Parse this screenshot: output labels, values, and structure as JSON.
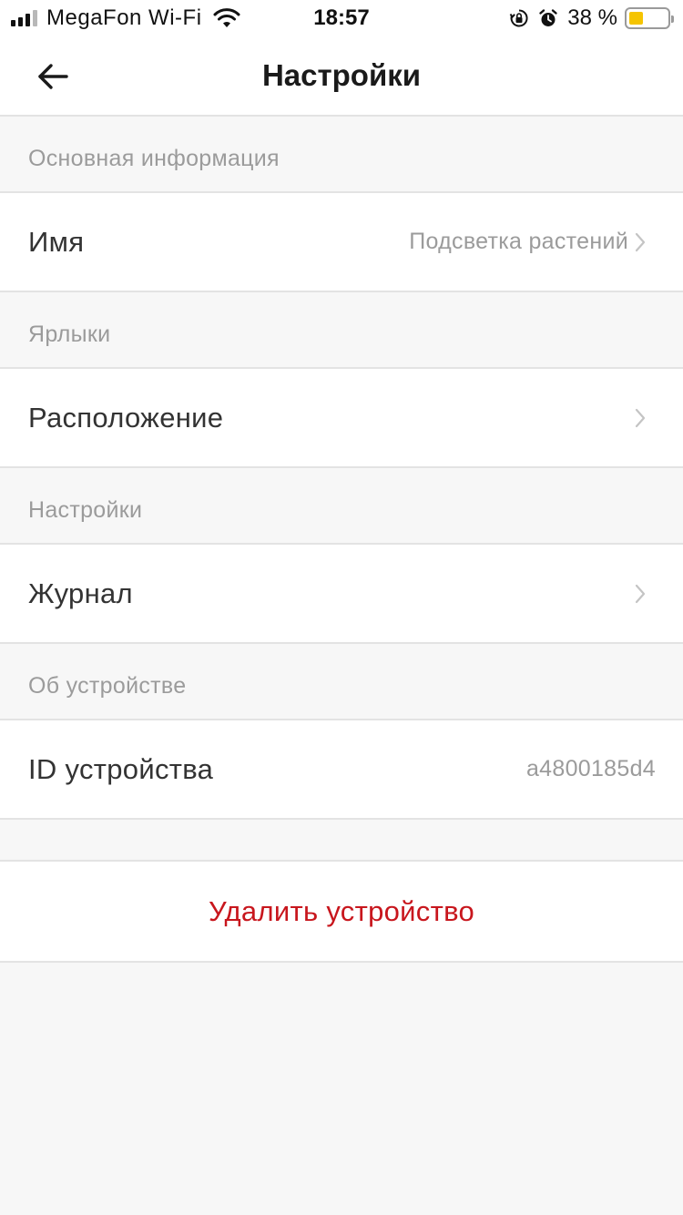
{
  "status_bar": {
    "carrier": "MegaFon Wi-Fi",
    "time": "18:57",
    "battery_percent": "38 %",
    "battery_level": 0.38,
    "battery_color": "#f5c400",
    "icons": [
      "signal-icon",
      "wifi-icon",
      "orientation-lock-icon",
      "alarm-icon",
      "battery-icon"
    ]
  },
  "header": {
    "title": "Настройки",
    "back_icon": "arrow-left-icon"
  },
  "sections": [
    {
      "header": "Основная информация",
      "rows": [
        {
          "label": "Имя",
          "value": "Подсветка растений",
          "chevron": true
        }
      ]
    },
    {
      "header": "Ярлыки",
      "rows": [
        {
          "label": "Расположение",
          "value": "",
          "chevron": true
        }
      ]
    },
    {
      "header": "Настройки",
      "rows": [
        {
          "label": "Журнал",
          "value": "",
          "chevron": true
        }
      ]
    },
    {
      "header": "Об устройстве",
      "rows": [
        {
          "label": "ID устройства",
          "value": "a4800185d4",
          "chevron": false
        }
      ]
    }
  ],
  "delete_button": {
    "label": "Удалить устройство",
    "color": "#c8161d"
  },
  "colors": {
    "background": "#f7f7f7",
    "surface": "#ffffff",
    "divider": "#e3e3e3",
    "secondary_text": "#9b9b9b",
    "primary_text": "#333333"
  }
}
